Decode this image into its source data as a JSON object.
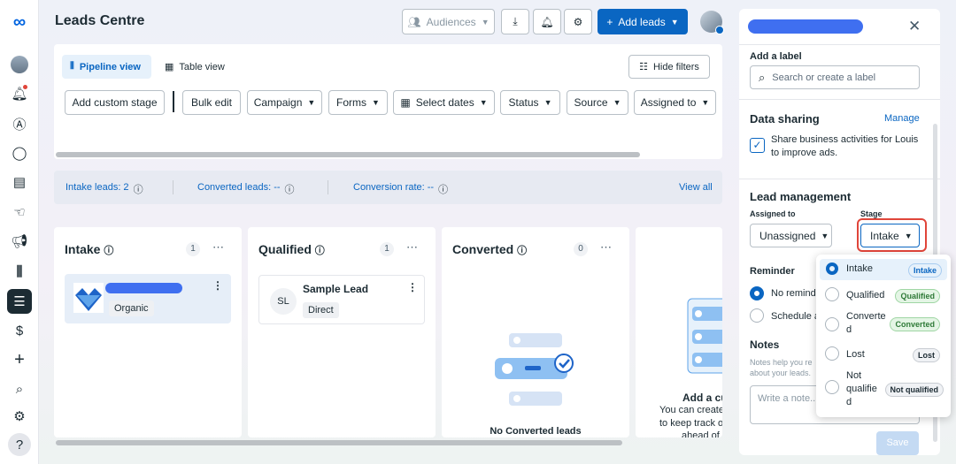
{
  "colors": {
    "accent": "#0a66c2",
    "brand": "#0064e0",
    "highlight": "#e0453a",
    "intake_bg": "#e6f1fb",
    "qualified_bg": "#e4f5e5",
    "converted_bg": "#e4f5e5"
  },
  "header": {
    "title": "Leads Centre",
    "audiences": "Audiences",
    "add_leads": "Add leads"
  },
  "views": {
    "pipeline": "Pipeline view",
    "table": "Table view",
    "hide_filters": "Hide filters"
  },
  "filters": {
    "add_custom_stage": "Add custom stage",
    "bulk_edit": "Bulk edit",
    "campaign": "Campaign",
    "forms": "Forms",
    "select_dates": "Select dates",
    "status": "Status",
    "source": "Source",
    "assigned_to": "Assigned to"
  },
  "stats": {
    "intake_label": "Intake leads: 2",
    "converted_label": "Converted leads: --",
    "conversion_label": "Conversion rate: --",
    "view_all": "View all"
  },
  "columns": [
    {
      "title": "Intake",
      "count": "1"
    },
    {
      "title": "Qualified",
      "count": "1"
    },
    {
      "title": "Converted",
      "count": "0"
    }
  ],
  "lead_cards": {
    "intake": {
      "source": "Organic"
    },
    "qualified": {
      "initials": "SL",
      "name": "Sample Lead",
      "source": "Direct"
    }
  },
  "empty_converted": "No Converted leads",
  "column4": {
    "heading": "Add a cu",
    "line1": "You can create",
    "line2": "to keep track o",
    "line3": "ahead of"
  },
  "panel": {
    "add_label": "Add a label",
    "label_placeholder": "Search or create a label",
    "data_sharing": "Data sharing",
    "manage": "Manage",
    "share_text_1": "Share business activities for Louis",
    "share_text_2": "to improve ads.",
    "lead_management": "Lead management",
    "assigned_to": "Assigned to",
    "assigned_value": "Unassigned",
    "stage": "Stage",
    "stage_value": "Intake",
    "reminder": "Reminder",
    "no_reminder": "No remind",
    "schedule": "Schedule a",
    "notes": "Notes",
    "notes_help_1": "Notes help you re",
    "notes_help_2": "about your leads.",
    "notes_placeholder": "Write a note...",
    "save": "Save"
  },
  "stage_options": [
    {
      "label": "Intake",
      "badge": "Intake",
      "selected": true
    },
    {
      "label": "Qualified",
      "badge": "Qualified"
    },
    {
      "label_1": "Converte",
      "label_2": "d",
      "badge": "Converted"
    },
    {
      "label": "Lost",
      "badge": "Lost"
    },
    {
      "label_1": "Not",
      "label_2": "qualifie",
      "label_3": "d",
      "badge": "Not qualified"
    }
  ],
  "icons": [
    "meta-logo",
    "profile-avatar",
    "notifications-icon",
    "ads-icon",
    "messages-icon",
    "content-icon",
    "engagement-icon",
    "megaphone-icon",
    "insights-icon",
    "menu-icon",
    "billing-icon",
    "add-icon",
    "search-icon",
    "settings-icon",
    "help-icon"
  ],
  "rail_help": "?"
}
